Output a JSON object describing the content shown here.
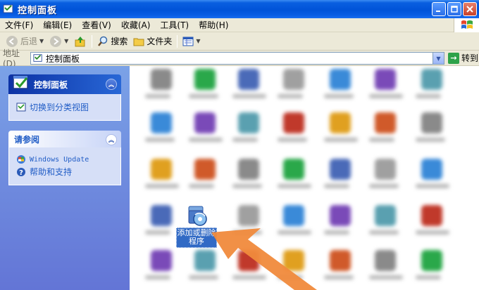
{
  "window": {
    "title": "控制面板"
  },
  "menu": [
    "文件(F)",
    "编辑(E)",
    "查看(V)",
    "收藏(A)",
    "工具(T)",
    "帮助(H)"
  ],
  "toolbar": {
    "back": "后退",
    "search": "搜索",
    "folders": "文件夹"
  },
  "address": {
    "label": "地址(D)",
    "value": "控制面板",
    "go": "转到"
  },
  "taskpane": {
    "control_panel": {
      "title": "控制面板",
      "switch_view": "切换到分类视图"
    },
    "see_also": {
      "title": "请参阅",
      "windows_update": "Windows Update",
      "help": "帮助和支持"
    }
  },
  "selected_item": {
    "label": "添加或删除程序"
  },
  "colors": {
    "selection": "#316ac5",
    "title_bar": "#0053d8",
    "task_pane": "#6f8fe0",
    "arrow": "#f08a3c"
  }
}
